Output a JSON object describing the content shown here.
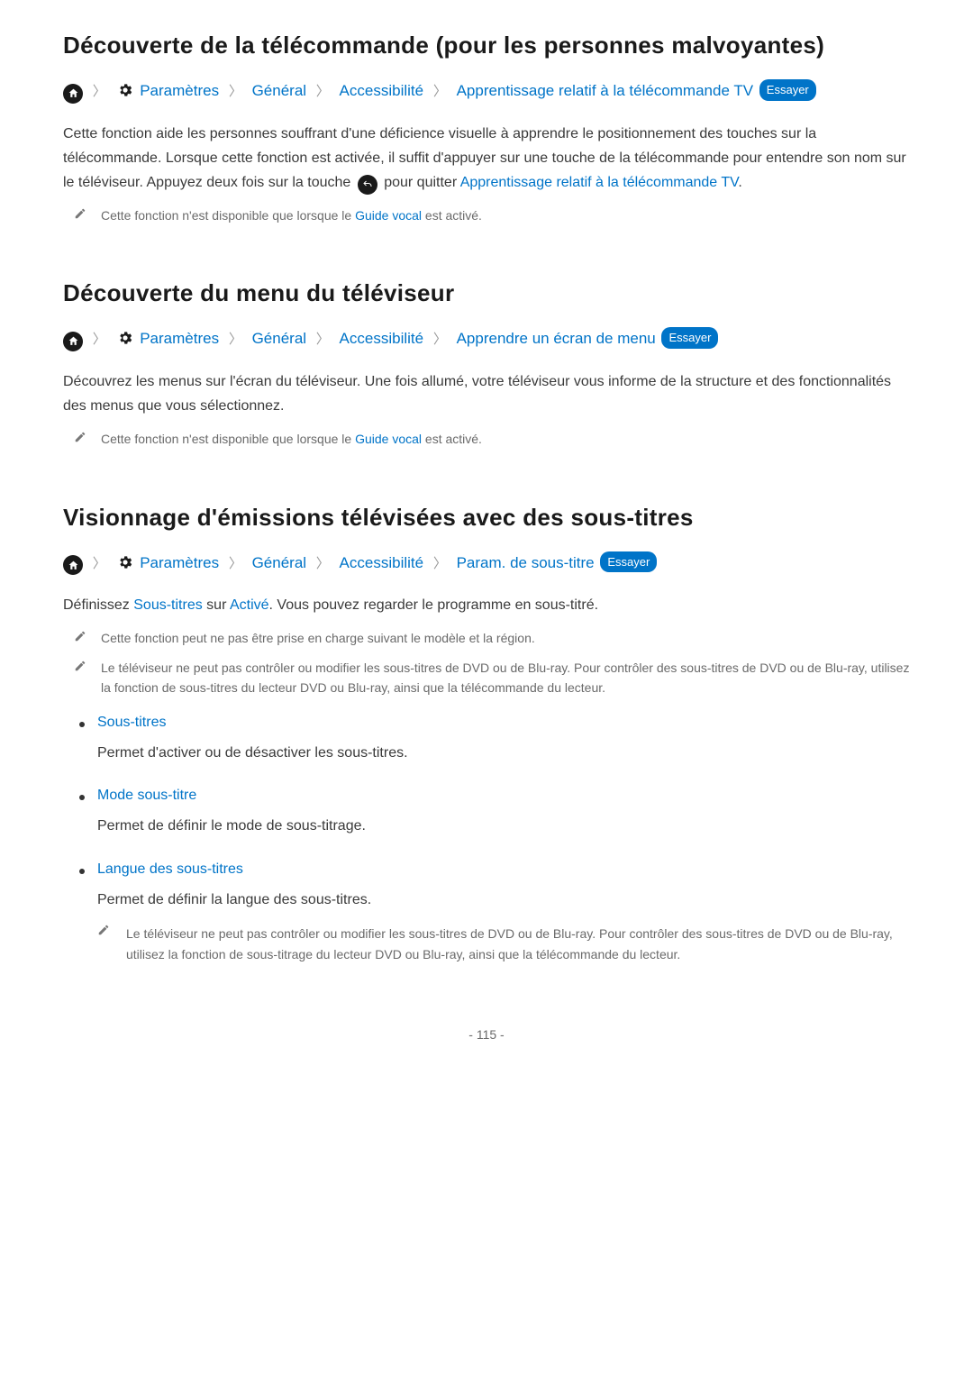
{
  "common": {
    "tryLabel": "Essayer",
    "pathParts": {
      "settings": "Paramètres",
      "general": "Général",
      "accessibility": "Accessibilité"
    }
  },
  "section1": {
    "heading": "Découverte de la télécommande (pour les personnes malvoyantes)",
    "pathLast": "Apprentissage relatif à la télécommande TV",
    "body": {
      "p1a": "Cette fonction aide les personnes souffrant d'une déficience visuelle à apprendre le positionnement des touches sur la télécommande. Lorsque cette fonction est activée, il suffit d'appuyer sur une touche de la télécommande pour entendre son nom sur le téléviseur. Appuyez deux fois sur la touche ",
      "p1b": " pour quitter ",
      "p1c": "Apprentissage relatif à la télécommande TV",
      "p1d": "."
    },
    "note": {
      "a": "Cette fonction n'est disponible que lorsque le ",
      "link": "Guide vocal",
      "b": " est activé."
    }
  },
  "section2": {
    "heading": "Découverte du menu du téléviseur",
    "pathLast": "Apprendre un écran de menu",
    "body": "Découvrez les menus sur l'écran du téléviseur. Une fois allumé, votre téléviseur vous informe de la structure et des fonctionnalités des menus que vous sélectionnez.",
    "note": {
      "a": "Cette fonction n'est disponible que lorsque le ",
      "link": "Guide vocal",
      "b": " est activé."
    }
  },
  "section3": {
    "heading": "Visionnage d'émissions télévisées avec des sous-titres",
    "pathLast": "Param. de sous-titre",
    "body": {
      "a": "Définissez ",
      "link1": "Sous-titres",
      "b": " sur ",
      "link2": "Activé",
      "c": ". Vous pouvez regarder le programme en sous-titré."
    },
    "note1": "Cette fonction peut ne pas être prise en charge suivant le modèle et la région.",
    "note2": "Le téléviseur ne peut pas contrôler ou modifier les sous-titres de DVD ou de Blu-ray. Pour contrôler des sous-titres de DVD ou de Blu-ray, utilisez la fonction de sous-titres du lecteur DVD ou Blu-ray, ainsi que la télécommande du lecteur.",
    "bullets": [
      {
        "title": "Sous-titres",
        "desc": "Permet d'activer ou de désactiver les sous-titres."
      },
      {
        "title": "Mode sous-titre",
        "desc": "Permet de définir le mode de sous-titrage."
      },
      {
        "title": "Langue des sous-titres",
        "desc": "Permet de définir la langue des sous-titres.",
        "note": "Le téléviseur ne peut pas contrôler ou modifier les sous-titres de DVD ou de Blu-ray. Pour contrôler des sous-titres de DVD ou de Blu-ray, utilisez la fonction de sous-titrage du lecteur DVD ou Blu-ray, ainsi que la télécommande du lecteur."
      }
    ]
  },
  "pageNumber": "- 115 -"
}
